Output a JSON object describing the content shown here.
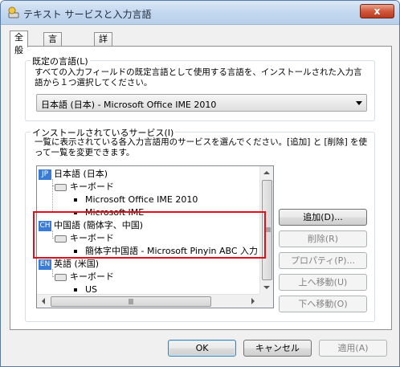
{
  "window": {
    "title": "テキスト サービスと入力言語",
    "close_label": "x"
  },
  "tabs": [
    {
      "label": "全般",
      "active": true
    },
    {
      "label": "言語バー",
      "active": false
    },
    {
      "label": "詳細なキー設定",
      "active": false
    }
  ],
  "default_language": {
    "legend": "既定の言語(L)",
    "description": "すべての入力フィールドの既定言語として使用する言語を、インストールされた入力言語から１つ選択してください。",
    "selected_value": "日本語 (日本) - Microsoft Office IME 2010"
  },
  "installed_services": {
    "legend": "インストールされているサービス(I)",
    "description": "一覧に表示されている各入力言語用のサービスを選んでください。[追加] と [削除] を使って一覧を変更できます。",
    "tree": [
      {
        "type": "language",
        "badge": "JP",
        "label": "日本語 (日本)"
      },
      {
        "type": "category",
        "label": "キーボード"
      },
      {
        "type": "service",
        "label": "Microsoft Office IME 2010"
      },
      {
        "type": "service",
        "label": "Microsoft IME"
      },
      {
        "type": "language",
        "badge": "CH",
        "label": "中国語 (簡体字、中国)"
      },
      {
        "type": "category",
        "label": "キーボード"
      },
      {
        "type": "service",
        "label": "簡体字中国語 - Microsoft Pinyin ABC 入力"
      },
      {
        "type": "language",
        "badge": "EN",
        "label": "英語 (米国)"
      },
      {
        "type": "category",
        "label": "キーボード"
      },
      {
        "type": "service",
        "label": "US"
      }
    ],
    "buttons": {
      "add": "追加(D)...",
      "remove": "削除(R)",
      "properties": "プロパティ(P)...",
      "move_up": "上へ移動(U)",
      "move_down": "下へ移動(O)"
    }
  },
  "footer": {
    "ok": "OK",
    "cancel": "キャンセル",
    "apply": "適用(A)"
  },
  "colors": {
    "highlight": "#e0101a",
    "lang_badge": "#3a7bd5"
  }
}
